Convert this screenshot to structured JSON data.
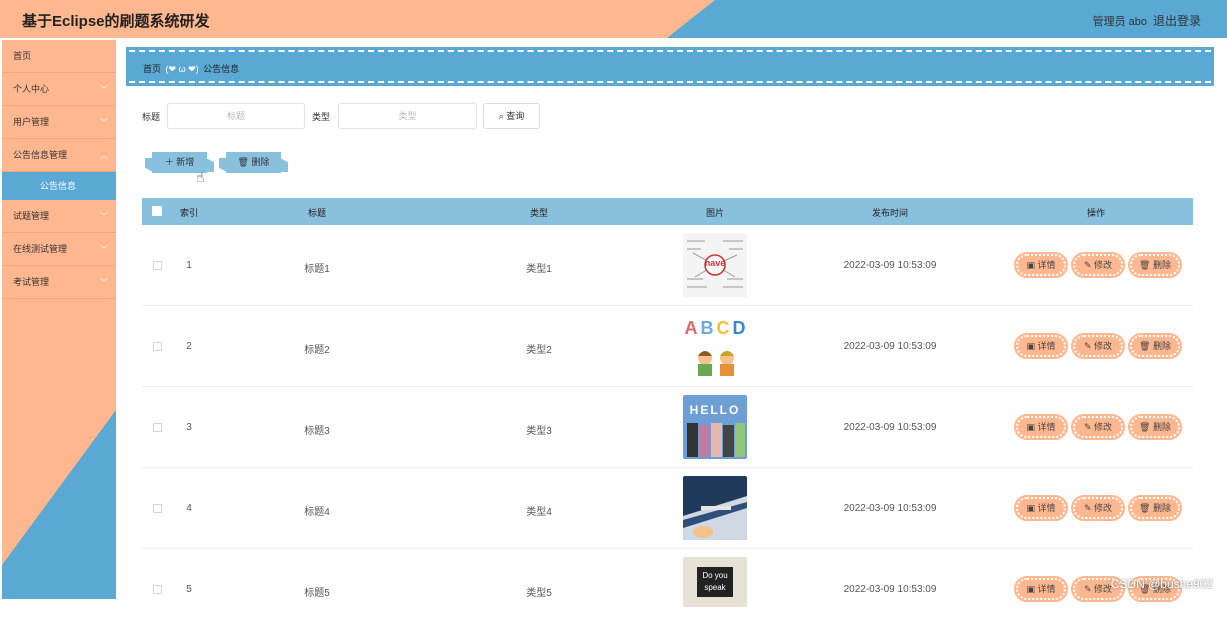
{
  "header": {
    "title": "基于Eclipse的刷题系统研发",
    "user": "管理员 abo",
    "logout": "退出登录"
  },
  "sidebar": {
    "items": [
      {
        "label": "首页",
        "chevron": false
      },
      {
        "label": "个人中心",
        "chevron": true
      },
      {
        "label": "用户管理",
        "chevron": true
      },
      {
        "label": "公告信息管理",
        "chevron": true
      }
    ],
    "sub_item": "公告信息",
    "items2": [
      {
        "label": "试题管理"
      },
      {
        "label": "在线测试管理"
      },
      {
        "label": "考试管理"
      }
    ]
  },
  "breadcrumb": {
    "home": "首页",
    "emoticon": "(❤ ω ❤)",
    "current": "公告信息"
  },
  "search": {
    "title_label": "标题",
    "title_placeholder": "标题",
    "type_label": "类型",
    "type_placeholder": "类型",
    "query_button": "查询",
    "query_icon": "search-icon"
  },
  "actions": {
    "add": "新增",
    "delete": "删除"
  },
  "table": {
    "columns": [
      "索引",
      "标题",
      "类型",
      "图片",
      "发布时间",
      "操作"
    ],
    "rows": [
      {
        "index": "1",
        "title": "标题1",
        "type": "类型1",
        "image": "word-cloud-have",
        "time": "2022-03-09 10:53:09"
      },
      {
        "index": "2",
        "title": "标题2",
        "type": "类型2",
        "image": "abcd-kids",
        "time": "2022-03-09 10:53:09"
      },
      {
        "index": "3",
        "title": "标题3",
        "type": "类型3",
        "image": "hello-people",
        "time": "2022-03-09 10:53:09"
      },
      {
        "index": "4",
        "title": "标题4",
        "type": "类型4",
        "image": "classroom-book",
        "time": "2022-03-09 10:53:09"
      },
      {
        "index": "5",
        "title": "标题5",
        "type": "类型5",
        "image": "do-you-speak",
        "time": "2022-03-09 10:53:09"
      }
    ],
    "row_actions": {
      "detail": "详情",
      "edit": "修改",
      "delete": "删除"
    }
  },
  "thumb_text": {
    "row1": "have",
    "row2": [
      "A",
      "B",
      "C",
      "D"
    ],
    "row3": "HELLO",
    "row5": [
      "Do you",
      "speak"
    ]
  },
  "watermark": "CSDN @bushe902",
  "colors": {
    "peach": "#ffb790",
    "blue": "#5aa8d4",
    "light_blue": "#88c0de"
  }
}
